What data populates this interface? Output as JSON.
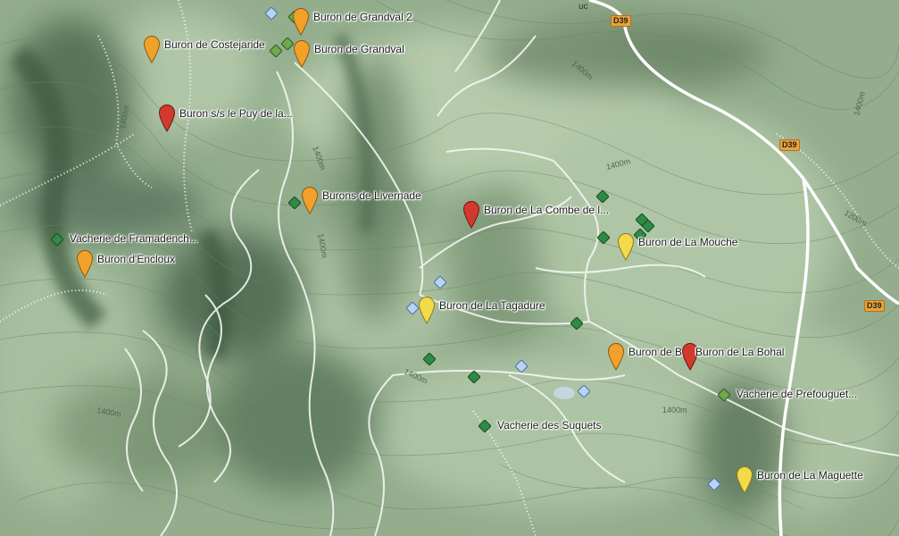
{
  "colors": {
    "pin_orange": "#f1a12a",
    "pin_red": "#d23a2e",
    "pin_yellow": "#f3da4a",
    "diamond_green": "#2e8b45",
    "diamond_lightgreen": "#6fa84d",
    "diamond_blue": "#b9d3f5"
  },
  "markers": [
    {
      "label": "Buron de Grandval 2",
      "icon": "map-pin-icon",
      "color": "orange"
    },
    {
      "label": "Buron de Costejaride",
      "icon": "map-pin-icon",
      "color": "orange"
    },
    {
      "label": "Buron de Grandval",
      "icon": "map-pin-icon",
      "color": "orange"
    },
    {
      "label": "Buron s/s le Puy de la...",
      "icon": "map-pin-icon",
      "color": "red"
    },
    {
      "label": "Burons de Livernade",
      "icon": "map-pin-icon",
      "color": "orange"
    },
    {
      "label": "Buron de La Combe de l...",
      "icon": "map-pin-icon",
      "color": "red"
    },
    {
      "label": "Vacherie de Framadench...",
      "icon": "diamond-icon",
      "color": "green"
    },
    {
      "label": "Buron d'Encloux",
      "icon": "map-pin-icon",
      "color": "orange"
    },
    {
      "label": "Buron de La Mouche",
      "icon": "map-pin-icon",
      "color": "yellow"
    },
    {
      "label": "Buron de La Tagadure",
      "icon": "map-pin-icon",
      "color": "yellow"
    },
    {
      "label": "Buron de Belle",
      "icon": "map-pin-icon",
      "color": "orange"
    },
    {
      "label": "Buron de La Bohal",
      "icon": "map-pin-icon",
      "color": "red"
    },
    {
      "label": "Vacherie de Prefouguet...",
      "icon": "diamond-icon",
      "color": "lightgreen"
    },
    {
      "label": "Vacherie des Suquets",
      "icon": "diamond-icon",
      "color": "green"
    },
    {
      "label": "Buron de La Maguette",
      "icon": "map-pin-icon",
      "color": "yellow"
    }
  ],
  "road_labels": [
    "D39",
    "D39",
    "D39"
  ],
  "contour_labels": [
    "1400m",
    "1400m",
    "1400m",
    "1400m",
    "1400m",
    "1400m",
    "1200m",
    "1400m",
    "1400m",
    "1400m"
  ],
  "edge_text": "uc"
}
